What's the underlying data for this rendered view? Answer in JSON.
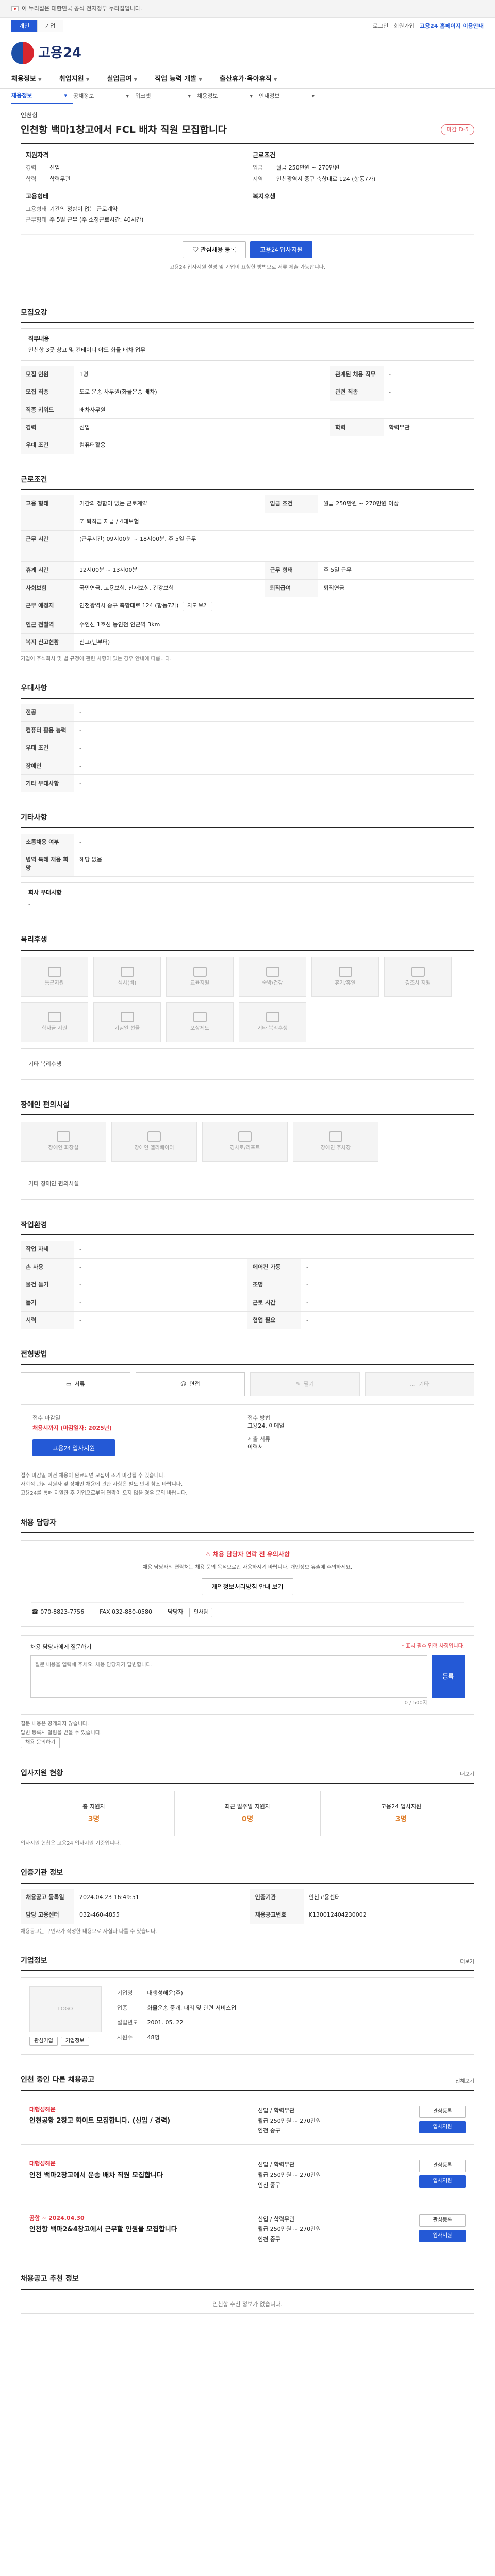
{
  "banner": {
    "text": "이 누리집은 대한민국 공식 전자정부 누리집입니다."
  },
  "util": {
    "tabs": [
      "개인",
      "기업"
    ],
    "links": [
      "로그인",
      "회원가입",
      "고용24 홈페이지 이용안내"
    ]
  },
  "logo": {
    "text": "고용24"
  },
  "gnb": [
    "채용정보",
    "취업지원",
    "실업급여",
    "직업 능력 개발",
    "출산휴가·육아휴직"
  ],
  "subnav": [
    "채용정보",
    "공채정보",
    "워크넷",
    "채용정보",
    "인재정보"
  ],
  "job": {
    "company": "인천항",
    "title": "인천항 백마1창고에서 FCL 배차 직원 모집합니다",
    "dday": "마감 D-5",
    "summary": {
      "left_title": "지원자격",
      "left_lines": [
        {
          "k": "경력",
          "v": "신입"
        },
        {
          "k": "학력",
          "v": "학력무관"
        }
      ],
      "left_sub_title": "고용형태",
      "left_sub_lines": [
        {
          "k": "고용형태",
          "v": "기간의 정함이 없는 근로계약"
        },
        {
          "k": "근무형태",
          "v": "주 5일 근무 (주 소정근로시간: 40시간)"
        }
      ],
      "right_title": "근로조건",
      "right_lines": [
        {
          "k": "임금",
          "v": "월급 250만원 ~ 270만원"
        },
        {
          "k": "지역",
          "v": "인천광역시 중구 축항대로 124 (항동7가)"
        }
      ],
      "right_sub_title": "복지후생",
      "right_sub_lines": []
    },
    "buttons": {
      "interest": "관심채용 등록",
      "apply": "고용24 입사지원"
    },
    "notice": "고용24 입사지원 설명 및 기업이 요청한 방법으로 서류 제출 가능합니다."
  },
  "recruit": {
    "title": "모집요강",
    "duty_title": "직무내용",
    "duty_text": "인천항 3곳 창고 및 컨테이너 야드 화물 배차 업무",
    "rows": [
      {
        "k": "모집 인원",
        "v": "1명",
        "k2": "관계된 채용 직무",
        "v2": "-"
      },
      {
        "k": "모집 직종",
        "v": "도로 운송 사무원(화물운송 배차)",
        "k2": "관련 직종",
        "v2": "-"
      },
      {
        "k": "직종 키워드",
        "v": "배차사무원",
        "k2": "",
        "v2": ""
      },
      {
        "k": "경력",
        "v": "신입",
        "k2": "학력",
        "v2": "학력무관"
      },
      {
        "k": "우대 조건",
        "v": "컴퓨터활용",
        "k2": "",
        "v2": ""
      }
    ]
  },
  "conditions": {
    "title": "근로조건",
    "rows": [
      {
        "k": "고용 형태",
        "v": "기간의 정함이 없는 근로계약",
        "k2": "임금 조건",
        "v2": "월급 250만원 ~ 270만원 이상"
      },
      {
        "k": "",
        "v": "퇴직금 지급 / 4대보험",
        "k2": "",
        "v2": ""
      },
      {
        "k": "근무 시간",
        "v": "(근무시간) 09시00분 ~ 18시00분, 주 5일 근무",
        "k2": "",
        "v2": ""
      },
      {
        "k": "휴게 시간",
        "v": "12시00분 ~ 13시00분",
        "k2": "근무 형태",
        "v2": "주 5일 근무"
      },
      {
        "k": "사회보험",
        "v": "국민연금, 고용보험, 산재보험, 건강보험",
        "k2": "퇴직급여",
        "v2": "퇴직연금"
      },
      {
        "k": "근무 예정지",
        "v": "인천광역시 중구 축항대로 124 (항동7가)",
        "k2": "",
        "v2": ""
      },
      {
        "k": "인근 전철역",
        "v": "수인선 1호선 동인천 인근역 3km",
        "k2": "",
        "v2": ""
      },
      {
        "k": "복지 신고현황",
        "v": "신고(년부터)",
        "k2": "",
        "v2": ""
      }
    ],
    "map_button": "지도 보기",
    "note": "기업이 주식회사 및 법 규정에 관련 사항이 있는 경우 안내에 따릅니다."
  },
  "prefer": {
    "title": "우대사항",
    "rows": [
      {
        "k": "전공",
        "v": "-"
      },
      {
        "k": "컴퓨터 활용 능력",
        "v": "-"
      },
      {
        "k": "우대 조건",
        "v": "-"
      },
      {
        "k": "장애인",
        "v": "-"
      },
      {
        "k": "기타 우대사항",
        "v": "-"
      }
    ]
  },
  "other": {
    "title": "기타사항",
    "rows": [
      {
        "k": "소통채용 여부",
        "v": "-"
      },
      {
        "k": "병역 특례 채용 희망",
        "v": "해당 없음"
      }
    ],
    "more_title": "회사 우대사항",
    "more_text": "-"
  },
  "welfare": {
    "title": "복리후생",
    "icons": [
      "통근지원",
      "식사(비)",
      "교육지원",
      "숙박/건강",
      "휴가/휴일",
      "경조사 지원",
      "학자금 지원",
      "기념일 선물",
      "포상제도",
      "기타 복리후생"
    ],
    "empty": "기타 복리후생"
  },
  "disabled": {
    "title": "장애인 편의시설",
    "icons": [
      "장애인 화장실",
      "장애인 엘리베이터",
      "경사로/리프트",
      "장애인 주차장"
    ],
    "empty": "기타 장애인 편의시설"
  },
  "env": {
    "title": "작업환경",
    "rows": [
      {
        "k": "작업 자세",
        "v": "-",
        "k2": "",
        "v2": ""
      },
      {
        "k": "손 사용",
        "v": "-",
        "k2": "에어컨 가동",
        "v2": "-"
      },
      {
        "k": "물건 들기",
        "v": "-",
        "k2": "조명",
        "v2": "-"
      },
      {
        "k": "듣기",
        "v": "-",
        "k2": "근로 시간",
        "v2": "-"
      },
      {
        "k": "시력",
        "v": "-",
        "k2": "협업 필요",
        "v2": "-"
      }
    ]
  },
  "process": {
    "title": "전형방법",
    "steps": [
      "서류",
      "면접",
      "필기",
      "기타"
    ],
    "left_label": "접수 마감일",
    "left_value": "채용시까지 (마감일자: 2025년)",
    "right_label": "접수 방법",
    "right_value": "고용24, 이메일",
    "right_label2": "제출 서류",
    "right_value2": "이력서",
    "apply": "고용24 입사지원",
    "notes": [
      "접수 마감일 이전 채용이 완료되면 모집이 조기 마감될 수 있습니다.",
      "사회적 관심 지원자 및 장애인 채용에 관한 사항은 별도 안내 참조 바랍니다.",
      "고용24를 통해 지원한 후 기업으로부터 연락이 오지 않을 경우 문의 바랍니다."
    ]
  },
  "contact": {
    "title": "채용 담당자",
    "warn_head": "채용 담당자 연락 전 유의사항",
    "warn_text": "채용 담당자의 연락처는 채용 문의 목적으로만 사용하시기 바랍니다. 개인정보 유출에 주의하세요.",
    "button": "개인정보처리방침 안내 보기",
    "fax": "032-880-0580",
    "phone": "070-8823-7756",
    "name_label": "담당자",
    "name": "인사팀"
  },
  "qa": {
    "title": "채용 담당자에게 질문하기",
    "required": "* 표시 필수 입력 사항입니다.",
    "placeholder": "질문 내용을 입력해 주세요. 채용 담당자가 답변합니다.",
    "counter": "0 / 500자",
    "submit": "등록",
    "notes": [
      "질문 내용은 공개되지 않습니다.",
      "답변 등록시 알림을 받을 수 있습니다."
    ],
    "more": "채용 문의하기"
  },
  "stats": {
    "title": "입사지원 현황",
    "link": "더보기",
    "cards": [
      {
        "label": "총 지원자",
        "num": "3명"
      },
      {
        "label": "최근 일주일 지원자",
        "num": "0명"
      },
      {
        "label": "고용24 입사지원",
        "num": "3명"
      }
    ],
    "note": "입사지원 현황은 고용24 입사지원 기준입니다."
  },
  "regist": {
    "title": "인증기관 정보",
    "rows": [
      {
        "k": "채용공고 등록일",
        "v": "2024.04.23 16:49:51",
        "k2": "인증기관",
        "v2": "인천고용센터"
      },
      {
        "k": "담당 고용센터",
        "v": "032-460-4855",
        "k2": "채용공고번호",
        "v2": "K130012404230002"
      }
    ],
    "note": "채용공고는 구인자가 작성한 내용으로 사실과 다를 수 있습니다."
  },
  "company": {
    "title": "기업정보",
    "link": "더보기",
    "logo": "LOGO",
    "rows": [
      {
        "k": "기업명",
        "v": "대행성해운(주)"
      },
      {
        "k": "업종",
        "v": "화물운송 중개, 대리 및 관련 서비스업"
      },
      {
        "k": "설립년도",
        "v": "2001. 05. 22"
      },
      {
        "k": "사원수",
        "v": "48명"
      }
    ],
    "buttons": [
      "관심기업",
      "기업정보"
    ]
  },
  "others": {
    "title": "인천 중인 다른 채용공고",
    "aside": "전체보기",
    "cards": [
      {
        "co": "대행성해운",
        "ttl": "인천공항 2창고 화이트 모집합니다. (신입 / 경력)",
        "info": [
          "신입 / 학력무관",
          "월급 250만원 ~ 270만원",
          "인천 중구"
        ]
      },
      {
        "co": "대행성해운",
        "ttl": "인천 백마2창고에서 운송 배차 직원 모집합니다",
        "info": [
          "신입 / 학력무관",
          "월급 250만원 ~ 270만원",
          "인천 중구"
        ]
      },
      {
        "co": "공항 ~ 2024.04.30",
        "ttl": "인천항 백마2&4창고에서 근무할 인원을 모집합니다",
        "info": [
          "신입 / 학력무관",
          "월급 250만원 ~ 270만원",
          "인천 중구"
        ]
      }
    ],
    "btn1": "관심등록",
    "btn2": "입사지원"
  },
  "tail": {
    "title": "채용공고 추천 정보",
    "empty": "인천항 추천 정보가 없습니다."
  }
}
